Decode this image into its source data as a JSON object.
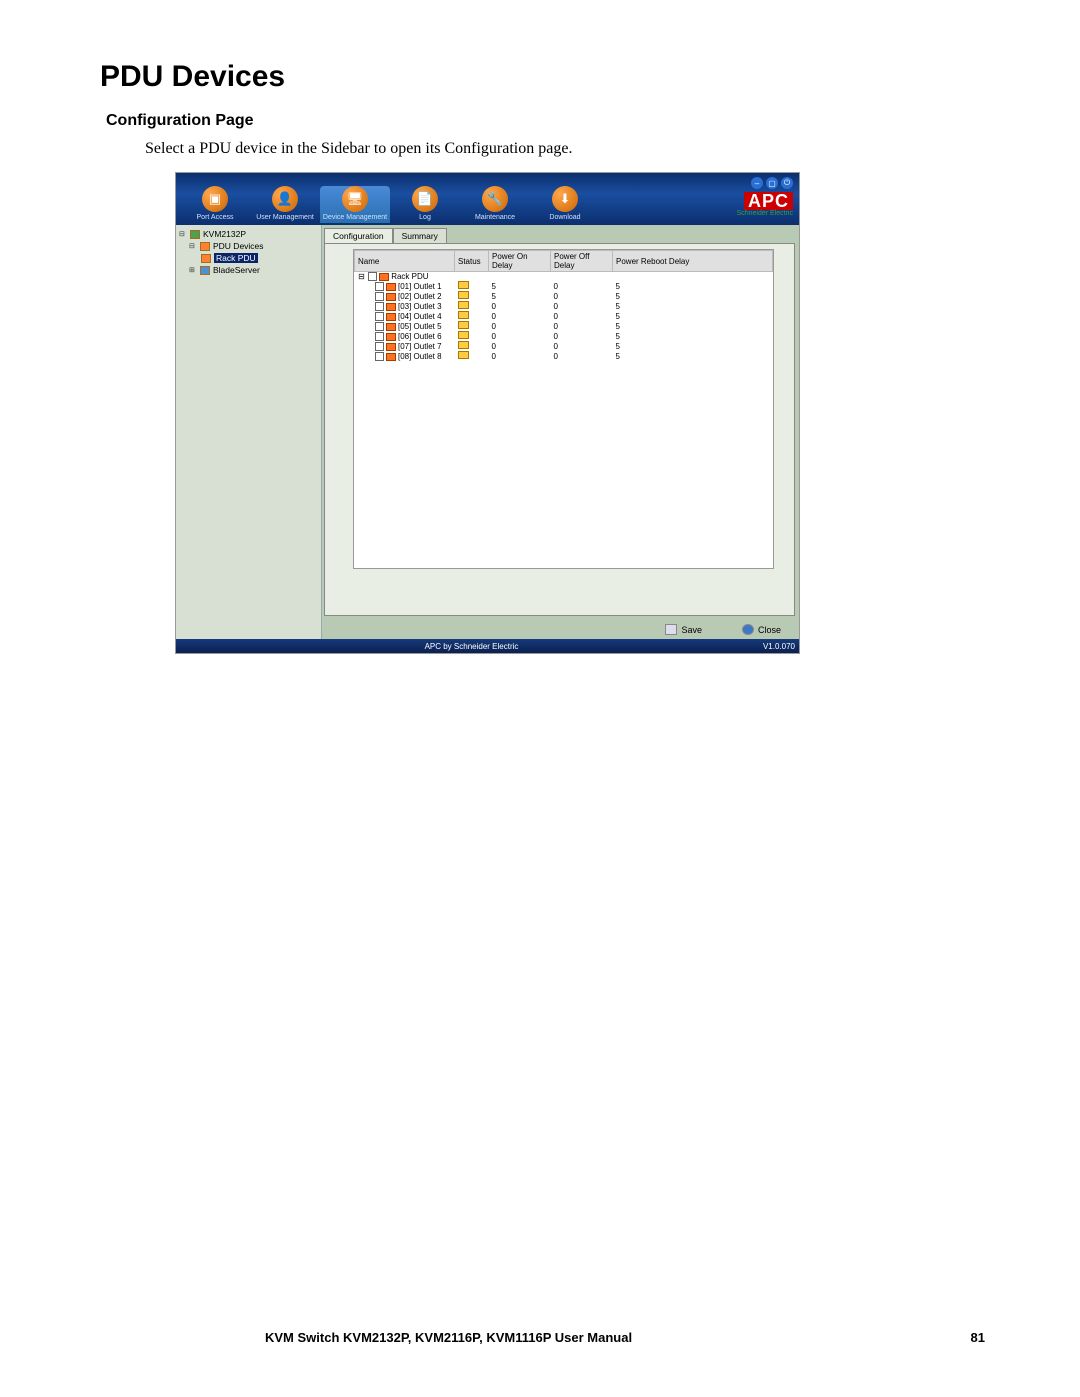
{
  "doc": {
    "title": "PDU Devices",
    "subtitle": "Configuration Page",
    "intro": "Select a PDU device in the Sidebar to open its Configuration page.",
    "footer_left": "KVM Switch KVM2132P, KVM2116P, KVM1116P User Manual",
    "footer_right": "81"
  },
  "toolbar": {
    "items": [
      {
        "label": "Port Access"
      },
      {
        "label": "User Management"
      },
      {
        "label": "Device Management"
      },
      {
        "label": "Log"
      },
      {
        "label": "Maintenance"
      },
      {
        "label": "Download"
      }
    ],
    "brand": "APC",
    "brand_sub": "Schneider Electric"
  },
  "sidebar": {
    "root": "KVM2132P",
    "pdu_group": "PDU Devices",
    "selected": "Rack PDU",
    "blade": "BladeServer"
  },
  "tabs": {
    "t0": "Configuration",
    "t1": "Summary"
  },
  "grid": {
    "headers": {
      "name": "Name",
      "status": "Status",
      "pon": "Power On Delay",
      "poff": "Power Off Delay",
      "preb": "Power Reboot Delay"
    },
    "root_row": "Rack PDU",
    "rows": [
      {
        "name": "[01] Outlet 1",
        "pon": "5",
        "poff": "0",
        "preb": "5"
      },
      {
        "name": "[02] Outlet 2",
        "pon": "5",
        "poff": "0",
        "preb": "5"
      },
      {
        "name": "[03] Outlet 3",
        "pon": "0",
        "poff": "0",
        "preb": "5"
      },
      {
        "name": "[04] Outlet 4",
        "pon": "0",
        "poff": "0",
        "preb": "5"
      },
      {
        "name": "[05] Outlet 5",
        "pon": "0",
        "poff": "0",
        "preb": "5"
      },
      {
        "name": "[06] Outlet 6",
        "pon": "0",
        "poff": "0",
        "preb": "5"
      },
      {
        "name": "[07] Outlet 7",
        "pon": "0",
        "poff": "0",
        "preb": "5"
      },
      {
        "name": "[08] Outlet 8",
        "pon": "0",
        "poff": "0",
        "preb": "5"
      }
    ]
  },
  "buttons": {
    "save": "Save",
    "close": "Close"
  },
  "statusbar": {
    "center": "APC by Schneider Electric",
    "right": "V1.0.070"
  }
}
